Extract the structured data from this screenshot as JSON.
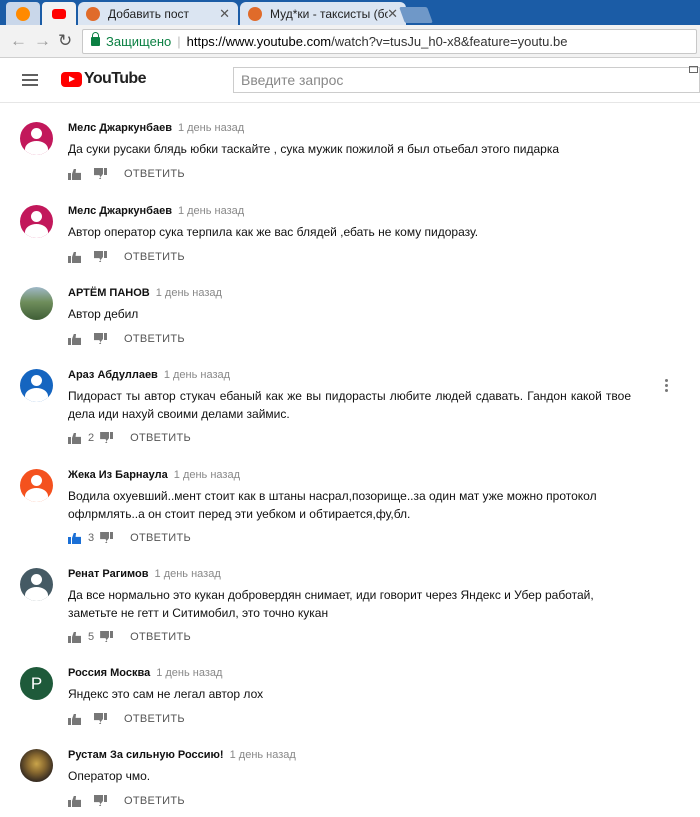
{
  "browser": {
    "tabs": [
      {
        "title": ""
      },
      {
        "title": ""
      },
      {
        "title": "Добавить пост"
      },
      {
        "title": "Муд*ки - таксисты (бом"
      }
    ],
    "secure_label": "Защищено",
    "url_host": "https://www.youtube.com",
    "url_path": "/watch?v=tusJu_h0-x8&feature=youtu.be"
  },
  "youtube": {
    "logo_text": "YouTube",
    "search_placeholder": "Введите запрос"
  },
  "reply_label": "ОТВЕТИТЬ",
  "comments": [
    {
      "author": "Мелс Джаркунбаев",
      "time": "1 день назад",
      "text": "Да суки русаки блядь юбки таскайте , сука мужик пожилой я был отьебал этого пидарка",
      "likes": "",
      "avatar_color": "#c2185b"
    },
    {
      "author": "Мелс Джаркунбаев",
      "time": "1 день назад",
      "text": "Автор оператор сука терпила как же вас блядей ,ебать не кому пидоразу.",
      "likes": "",
      "avatar_color": "#c2185b"
    },
    {
      "author": "АРТЁМ ПАНОВ",
      "time": "1 день назад",
      "text": "Автор дебил",
      "likes": "",
      "avatar_color": "#5a7a52"
    },
    {
      "author": "Араз Абдуллаев",
      "time": "1 день назад",
      "text": "Пидораст ты автор стукач ебаный как же вы пидорасты любите людей сдавать. Гандон какой твое дела иди нахуй своими делами займис.",
      "likes": "2",
      "avatar_color": "#1565c0"
    },
    {
      "author": "Жека Из Барнаула",
      "time": "1 день назад",
      "text": "Водила охуевший..мент стоит как в штаны насрал,позорище..за один мат уже можно протокол офлрмлять..а он стоит перед эти уебком и обтирается,фу,бл.",
      "likes": "3",
      "avatar_color": "#f4511e"
    },
    {
      "author": "Ренат Рагимов",
      "time": "1 день назад",
      "text": "Да все нормально это кукан добровердян снимает, иди говорит через Яндекс и Убер работай, заметьте не гетт и Ситимобил, это точно кукан",
      "likes": "5",
      "avatar_color": "#455a64"
    },
    {
      "author": "Россия Москва",
      "time": "1 день назад",
      "text": "Яндекс это сам не легал автор лох",
      "likes": "",
      "avatar_color": "#1e5a3a",
      "avatar_letter": "Р"
    },
    {
      "author": "Рустам За сильную Россию!",
      "time": "1 день назад",
      "text": "Оператор чмо.",
      "likes": "",
      "avatar_color": "#6b5a3a"
    }
  ]
}
